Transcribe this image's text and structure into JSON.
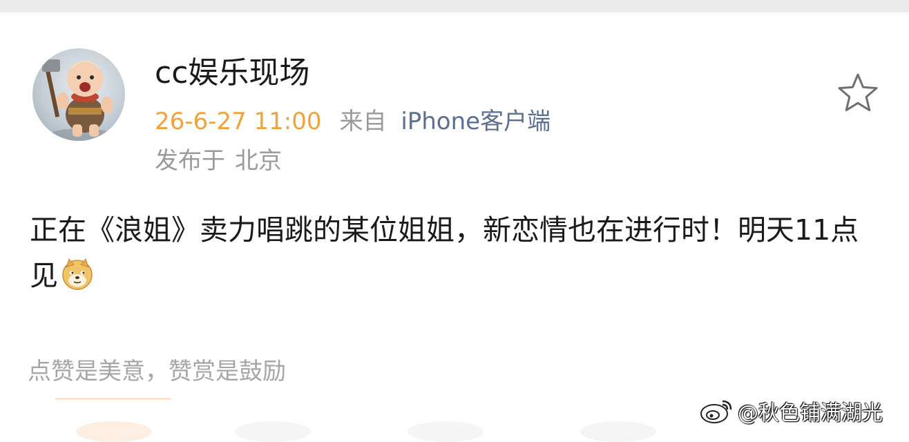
{
  "post": {
    "author": "cc娱乐现场",
    "timestamp": "26-6-27 11:00",
    "source_prefix": "来自",
    "source_device": "iPhone客户端",
    "location_prefix": "发布于",
    "location": "北京",
    "text": "正在《浪姐》卖力唱跳的某位姐姐，新恋情也在进行时！明天11点见",
    "emoji_icon": "doge-emoji-icon",
    "favorite_icon": "star-outline-icon"
  },
  "reward": {
    "label": "点赞是美意，赞赏是鼓励"
  },
  "watermark": {
    "text": "@秋色铺满湖光",
    "logo_icon": "weibo-logo-icon"
  },
  "colors": {
    "timestamp": "#f0a33c",
    "device_link": "#5b6f93",
    "secondary_text": "#9a9a9a"
  }
}
